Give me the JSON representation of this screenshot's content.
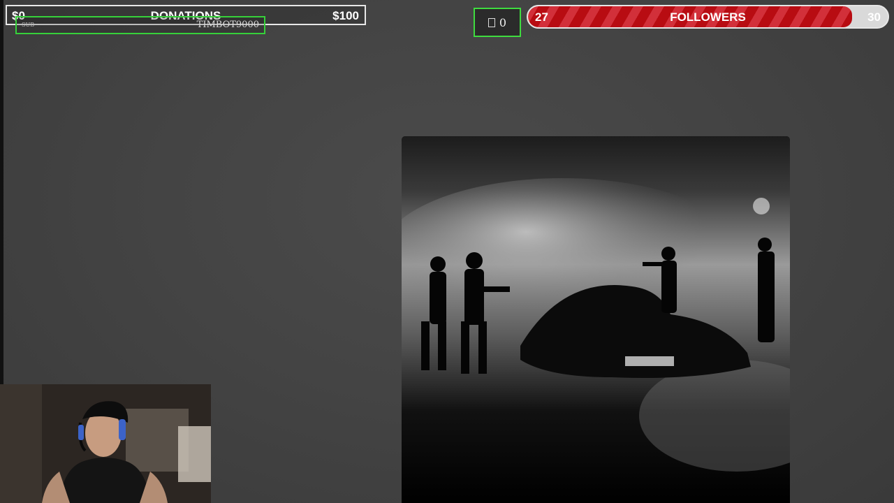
{
  "donations": {
    "min": "$0",
    "title": "DONATIONS",
    "max": "$100",
    "progress": 0.0
  },
  "sub_alert": {
    "tag": "SUB",
    "name": "TIMBOT9000"
  },
  "counter": {
    "icon": "box-icon",
    "value": "0"
  },
  "followers": {
    "min": "27",
    "title": "FOLLOWERS",
    "max": "30",
    "progress": 0.9
  },
  "colors": {
    "accent_green": "#3fdc3f",
    "followers_red": "#b80c12"
  }
}
